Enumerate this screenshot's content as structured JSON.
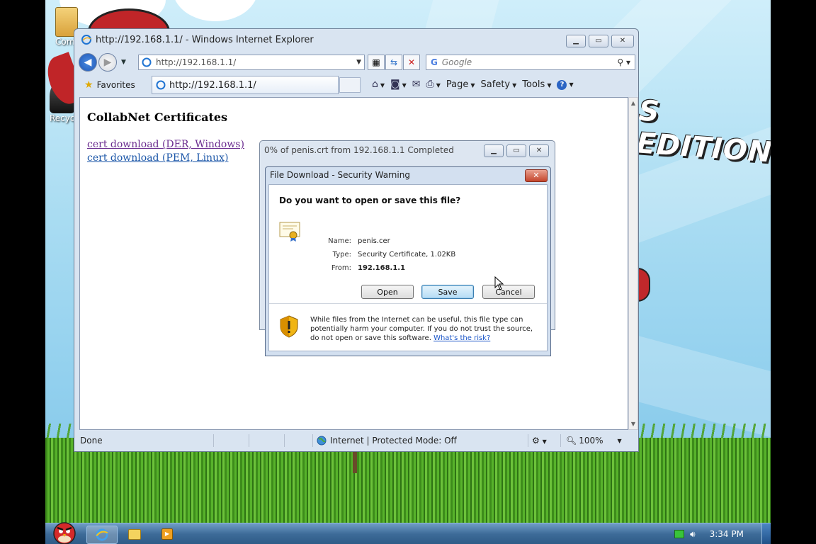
{
  "window": {
    "title": "http://192.168.1.1/ - Windows Internet Explorer",
    "address": "http://192.168.1.1/",
    "search_placeholder": "Google",
    "tab_title": "http://192.168.1.1/"
  },
  "commandbar": {
    "favorites": "Favorites",
    "page": "Page",
    "safety": "Safety",
    "tools": "Tools"
  },
  "page": {
    "heading": "CollabNet Certificates",
    "links": [
      "cert download (DER, Windows)",
      "cert download (PEM, Linux)"
    ]
  },
  "status": {
    "text": "Done",
    "zone": "Internet | Protected Mode: Off",
    "zoom": "100%"
  },
  "progress_dialog": {
    "title": "0% of penis.crt from 192.168.1.1 Completed"
  },
  "security_dialog": {
    "title": "File Download - Security Warning",
    "question": "Do you want to open or save this file?",
    "fields": [
      {
        "label": "Name:",
        "value": "penis.cer"
      },
      {
        "label": "Type:",
        "value": "Security Certificate, 1.02KB"
      },
      {
        "label": "From:",
        "value": "192.168.1.1"
      }
    ],
    "buttons": {
      "open": "Open",
      "save": "Save",
      "cancel": "Cancel"
    },
    "warning": "While files from the Internet can be useful, this file type can potentially harm your computer. If you do not trust the source, do not open or save this software.",
    "risk_link": "What's the risk?"
  },
  "desktop": {
    "banner": "S EDITION",
    "icons": [
      "Comp",
      "Recyc"
    ]
  },
  "taskbar": {
    "clock": "3:34 PM"
  },
  "colors": {
    "link_visited": "#6a2b8f",
    "link": "#1b56a8",
    "title_close": "#c4452c"
  }
}
